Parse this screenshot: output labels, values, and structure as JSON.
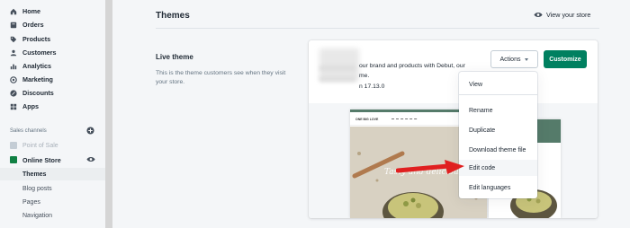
{
  "sidebar": {
    "items": [
      {
        "label": "Home",
        "icon": "home-icon"
      },
      {
        "label": "Orders",
        "icon": "orders-icon"
      },
      {
        "label": "Products",
        "icon": "tag-icon"
      },
      {
        "label": "Customers",
        "icon": "person-icon"
      },
      {
        "label": "Analytics",
        "icon": "chart-icon"
      },
      {
        "label": "Marketing",
        "icon": "target-icon"
      },
      {
        "label": "Discounts",
        "icon": "discount-icon"
      },
      {
        "label": "Apps",
        "icon": "apps-icon"
      }
    ],
    "section_label": "Sales channels",
    "point_of_sale": "Point of Sale",
    "online_store": "Online Store",
    "sub_items": [
      "Themes",
      "Blog posts",
      "Pages",
      "Navigation"
    ]
  },
  "header": {
    "title": "Themes",
    "view_store": "View your store"
  },
  "live_theme": {
    "title": "Live theme",
    "description": "This is the theme customers see when they visit your store."
  },
  "card": {
    "text_line1": "our brand and products with Debut, our",
    "text_line2": "me.",
    "text_line3": "n 17.13.0",
    "actions_label": "Actions",
    "customize_label": "Customize",
    "preview_logo": "ONE BIG LOVE",
    "preview_hero_text": "Tasty and delicious"
  },
  "dropdown": {
    "items": [
      "View",
      "Rename",
      "Duplicate",
      "Download theme file",
      "Edit code",
      "Edit languages"
    ],
    "highlighted": "Edit code"
  },
  "colors": {
    "accent_green": "#008060",
    "active_bar": "#5c6ac4",
    "arrow_red": "#e02020"
  }
}
